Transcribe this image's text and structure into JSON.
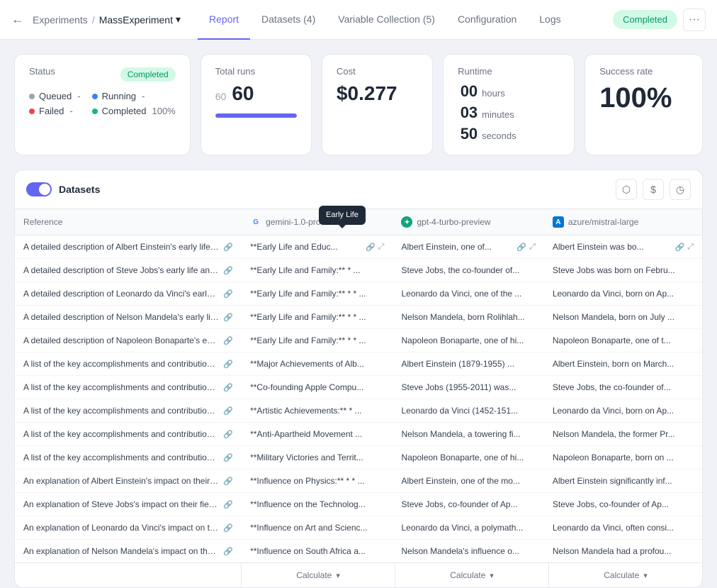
{
  "nav": {
    "back_label": "←",
    "experiments_label": "Experiments",
    "separator": "/",
    "experiment_name": "MassExperiment",
    "chevron": "▾",
    "tabs": [
      {
        "id": "report",
        "label": "Report",
        "active": true
      },
      {
        "id": "datasets",
        "label": "Datasets (4)",
        "active": false
      },
      {
        "id": "variable_collection",
        "label": "Variable Collection (5)",
        "active": false
      },
      {
        "id": "configuration",
        "label": "Configuration",
        "active": false
      },
      {
        "id": "logs",
        "label": "Logs",
        "active": false
      }
    ],
    "completed_badge": "Completed",
    "more_btn": "···"
  },
  "stats": {
    "status": {
      "label": "Status",
      "badge": "Completed",
      "items": [
        {
          "id": "queued",
          "dot": "gray",
          "label": "Queued",
          "value": "-"
        },
        {
          "id": "running",
          "dot": "blue",
          "label": "Running",
          "value": "-"
        },
        {
          "id": "failed",
          "dot": "red",
          "label": "Failed",
          "value": "-"
        },
        {
          "id": "completed",
          "dot": "green",
          "label": "Completed",
          "value": "100%"
        }
      ]
    },
    "total_runs": {
      "label": "Total runs",
      "start": "60",
      "end": "60",
      "bar_pct": 100
    },
    "cost": {
      "label": "Cost",
      "value": "$0.277"
    },
    "runtime": {
      "label": "Runtime",
      "hours": "00",
      "minutes": "03",
      "seconds": "50",
      "hours_unit": "hours",
      "minutes_unit": "minutes",
      "seconds_unit": "seconds"
    },
    "success_rate": {
      "label": "Success rate",
      "value": "100%"
    }
  },
  "datasets": {
    "toggle_label": "Datasets",
    "icons": {
      "share": "⬡",
      "dollar": "$",
      "clock": "◷"
    }
  },
  "table": {
    "headers": {
      "reference": "Reference",
      "gemini": "gemini-1.0-pro",
      "gpt": "gpt-4-turbo-preview",
      "azure": "azure/mistral-large"
    },
    "rows": [
      {
        "reference": "A detailed description of Albert Einstein's early life and upbringing.",
        "gemini": "**Early Life and Educ...",
        "gpt": "Albert Einstein, one of...",
        "azure": "Albert Einstein was bo..."
      },
      {
        "reference": "A detailed description of Steve Jobs's early life and upbringing.",
        "gemini": "**Early Life and Family:** * ...",
        "gpt": "Steve Jobs, the co-founder of...",
        "azure": "Steve Jobs was born on Febru..."
      },
      {
        "reference": "A detailed description of Leonardo da Vinci's early life and upbringing.",
        "gemini": "**Early Life and Family:** * * ...",
        "gpt": "Leonardo da Vinci, one of the ...",
        "azure": "Leonardo da Vinci, born on Ap..."
      },
      {
        "reference": "A detailed description of Nelson Mandela's early life and upbringing.",
        "gemini": "**Early Life and Family:** * * ...",
        "gpt": "Nelson Mandela, born Rolihlah...",
        "azure": "Nelson Mandela, born on July ..."
      },
      {
        "reference": "A detailed description of Napoleon Bonaparte's early life and upbringing.",
        "gemini": "**Early Life and Family:** * * ...",
        "gpt": "Napoleon Bonaparte, one of hi...",
        "azure": "Napoleon Bonaparte, one of t..."
      },
      {
        "reference": "A list of the key accomplishments and contributions of Albert Einstein.",
        "gemini": "**Major Achievements of Alb...",
        "gpt": "Albert Einstein (1879-1955) ...",
        "azure": "Albert Einstein, born on March..."
      },
      {
        "reference": "A list of the key accomplishments and contributions of Steve Jobs.",
        "gemini": "**Co-founding Apple Compu...",
        "gpt": "Steve Jobs (1955-2011) was...",
        "azure": "Steve Jobs, the co-founder of..."
      },
      {
        "reference": "A list of the key accomplishments and contributions of Leonardo da Vinci.",
        "gemini": "**Artistic Achievements:** * ...",
        "gpt": "Leonardo da Vinci (1452-151...",
        "azure": "Leonardo da Vinci, born on Ap..."
      },
      {
        "reference": "A list of the key accomplishments and contributions of Nelson Mandela.",
        "gemini": "**Anti-Apartheid Movement ...",
        "gpt": "Nelson Mandela, a towering fi...",
        "azure": "Nelson Mandela, the former Pr..."
      },
      {
        "reference": "A list of the key accomplishments and contributions of Napoleon Bonaparte.",
        "gemini": "**Military Victories and Territ...",
        "gpt": "Napoleon Bonaparte, one of hi...",
        "azure": "Napoleon Bonaparte, born on ..."
      },
      {
        "reference": "An explanation of Albert Einstein's impact on their field of work or society at large.",
        "gemini": "**Influence on Physics:** * * ...",
        "gpt": "Albert Einstein, one of the mo...",
        "azure": "Albert Einstein significantly inf..."
      },
      {
        "reference": "An explanation of Steve Jobs's impact on their field of work or society at large.",
        "gemini": "**Influence on the Technolog...",
        "gpt": "Steve Jobs, co-founder of Ap...",
        "azure": "Steve Jobs, co-founder of Ap..."
      },
      {
        "reference": "An explanation of Leonardo da Vinci's impact on their field of work or society at lar...",
        "gemini": "**Influence on Art and Scienc...",
        "gpt": "Leonardo da Vinci, a polymath...",
        "azure": "Leonardo da Vinci, often consi..."
      },
      {
        "reference": "An explanation of Nelson Mandela's impact on their field of work or society at large.",
        "gemini": "**Influence on South Africa a...",
        "gpt": "Nelson Mandela's influence o...",
        "azure": "Nelson Mandela had a profou..."
      }
    ],
    "footer": {
      "gemini_calculate": "Calculate",
      "gpt_calculate": "Calculate",
      "azure_calculate": "Calculate"
    }
  },
  "tooltip": {
    "text": "Early Life"
  }
}
